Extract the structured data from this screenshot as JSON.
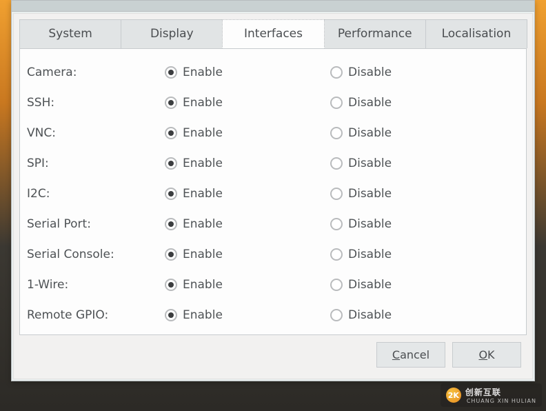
{
  "tabs": [
    {
      "id": "system",
      "label": "System",
      "active": false
    },
    {
      "id": "display",
      "label": "Display",
      "active": false
    },
    {
      "id": "interfaces",
      "label": "Interfaces",
      "active": true
    },
    {
      "id": "performance",
      "label": "Performance",
      "active": false
    },
    {
      "id": "localisation",
      "label": "Localisation",
      "active": false
    }
  ],
  "radio_labels": {
    "enable": "Enable",
    "disable": "Disable"
  },
  "interfaces": [
    {
      "id": "camera",
      "label": "Camera:",
      "value": "enable"
    },
    {
      "id": "ssh",
      "label": "SSH:",
      "value": "enable"
    },
    {
      "id": "vnc",
      "label": "VNC:",
      "value": "enable"
    },
    {
      "id": "spi",
      "label": "SPI:",
      "value": "enable"
    },
    {
      "id": "i2c",
      "label": "I2C:",
      "value": "enable"
    },
    {
      "id": "serial-port",
      "label": "Serial Port:",
      "value": "enable"
    },
    {
      "id": "serial-console",
      "label": "Serial Console:",
      "value": "enable"
    },
    {
      "id": "one-wire",
      "label": "1-Wire:",
      "value": "enable"
    },
    {
      "id": "remote-gpio",
      "label": "Remote GPIO:",
      "value": "enable"
    }
  ],
  "buttons": {
    "cancel": "Cancel",
    "ok": "OK"
  },
  "watermark": {
    "brand": "创新互联",
    "sub": "CHUANG XIN HULIAN",
    "logo": "2K"
  }
}
